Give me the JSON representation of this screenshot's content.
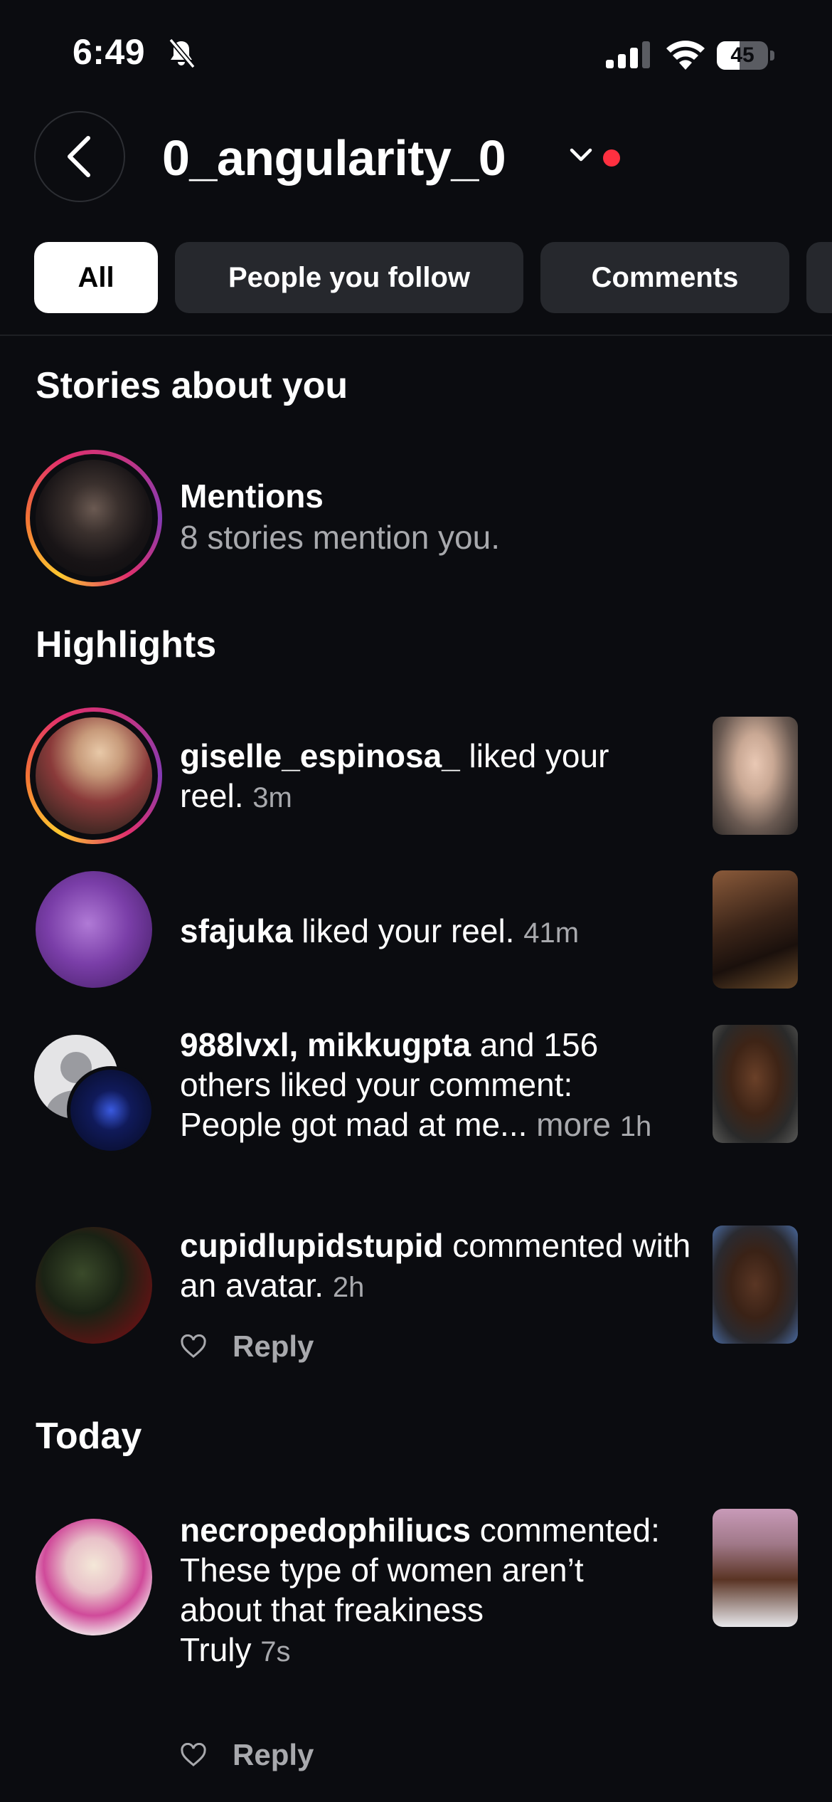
{
  "status_bar": {
    "time": "6:49",
    "battery": "45",
    "battery_fraction": 0.45
  },
  "header": {
    "account": "0_angularity_0"
  },
  "tabs": [
    {
      "label": "All",
      "active": true
    },
    {
      "label": "People you follow",
      "active": false
    },
    {
      "label": "Comments",
      "active": false
    }
  ],
  "sections": {
    "stories": "Stories about you",
    "highlights": "Highlights",
    "today": "Today"
  },
  "mentions": {
    "title": "Mentions",
    "subtitle": "8 stories mention you."
  },
  "notifications": [
    {
      "user": "giselle_espinosa_",
      "text": " liked your reel.",
      "time": "3m"
    },
    {
      "user": "sfajuka",
      "text": " liked your reel.",
      "time": "41m"
    },
    {
      "user": "988lvxl, mikkugpta",
      "text": " and 156 others liked your comment: People got mad at me...",
      "more": "more",
      "time": "1h"
    },
    {
      "user": "cupidlupidstupid",
      "text": " commented with an avatar.",
      "time": "2h",
      "reply": "Reply"
    },
    {
      "user": "necropedophiliucs",
      "text": " commented: These type of women aren’t about that freakiness",
      "extra": "Truly",
      "time": "7s",
      "reply": "Reply"
    }
  ],
  "colors": {
    "background": "#0b0c10",
    "accent_red": "#ff3040",
    "muted": "#a8a9ad",
    "chip": "#26282d"
  },
  "icons": [
    "bell-slash-icon",
    "cellular-signal-icon",
    "wifi-icon",
    "battery-icon",
    "chevron-left-icon",
    "chevron-down-icon",
    "heart-icon"
  ]
}
